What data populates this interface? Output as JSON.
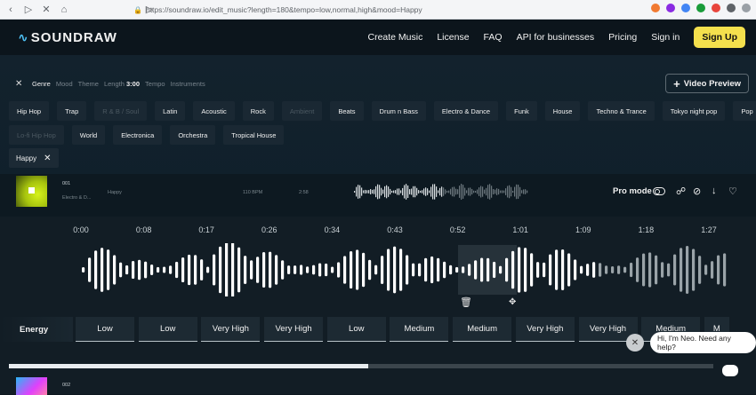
{
  "browser": {
    "url": "https://soundraw.io/edit_music?length=180&tempo=low,normal,high&mood=Happy"
  },
  "header": {
    "logo": "SOUNDRAW",
    "nav": [
      "Create Music",
      "License",
      "FAQ",
      "API for businesses",
      "Pricing",
      "Sign in"
    ],
    "signup": "Sign Up"
  },
  "filters": {
    "tabs": [
      "Genre",
      "Mood",
      "Theme",
      "Length",
      "Tempo",
      "Instruments"
    ],
    "length_value": "3:00",
    "video_preview": "Video Preview"
  },
  "genres_row1": [
    {
      "label": "Hip Hop",
      "dim": false
    },
    {
      "label": "Trap",
      "dim": false
    },
    {
      "label": "R & B / Soul",
      "dim": true
    },
    {
      "label": "Latin",
      "dim": false
    },
    {
      "label": "Acoustic",
      "dim": false
    },
    {
      "label": "Rock",
      "dim": false
    },
    {
      "label": "Ambient",
      "dim": true
    },
    {
      "label": "Beats",
      "dim": false
    },
    {
      "label": "Drum n Bass",
      "dim": false
    },
    {
      "label": "Electro & Dance",
      "dim": false
    },
    {
      "label": "Funk",
      "dim": false
    },
    {
      "label": "House",
      "dim": false
    },
    {
      "label": "Techno & Trance",
      "dim": false
    },
    {
      "label": "Tokyo night pop",
      "dim": false
    },
    {
      "label": "Pop",
      "dim": false
    }
  ],
  "genres_row2": [
    {
      "label": "Lo-fi Hip Hop",
      "dim": true
    },
    {
      "label": "World",
      "dim": false
    },
    {
      "label": "Electronica",
      "dim": false
    },
    {
      "label": "Orchestra",
      "dim": false
    },
    {
      "label": "Tropical House",
      "dim": false
    }
  ],
  "selected_mood": "Happy",
  "track": {
    "number": "001",
    "genre": "Electro & D...",
    "mood": "Happy",
    "bpm": "110 BPM",
    "length": "2:58",
    "pro_mode_label": "Pro mode"
  },
  "timeline": [
    "0:00",
    "0:08",
    "0:17",
    "0:26",
    "0:34",
    "0:43",
    "0:52",
    "1:01",
    "1:09",
    "1:18",
    "1:27"
  ],
  "energy": {
    "label": "Energy",
    "cells": [
      "Low",
      "Low",
      "Very High",
      "Very High",
      "Low",
      "Medium",
      "Medium",
      "Very High",
      "Very High",
      "Medium",
      "M"
    ]
  },
  "next_track": {
    "number": "002"
  },
  "chat": {
    "message": "Hi, I'm Neo. Need any help?"
  }
}
